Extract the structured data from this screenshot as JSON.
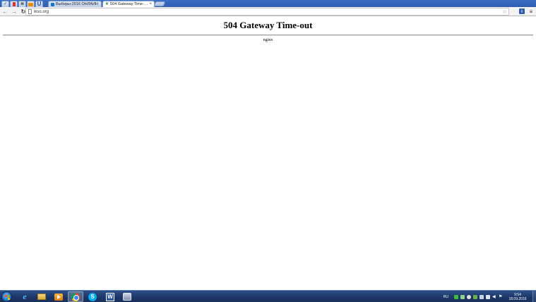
{
  "browser": {
    "tabs": [
      {
        "title": "Выборы-2016 ОНЛАЙН",
        "active": false
      },
      {
        "title": "504 Gateway Time-out",
        "active": true
      }
    ],
    "pinned_tabs": [
      {
        "icon": "vk-icon"
      },
      {
        "icon": "red-bookmark-icon"
      },
      {
        "icon": "wifi-icon"
      },
      {
        "icon": "orange-envelope-icon"
      },
      {
        "icon": "u-icon"
      }
    ],
    "address": "ikso.org",
    "close_glyph": "×"
  },
  "page": {
    "heading": "504 Gateway Time-out",
    "server": "nginx"
  },
  "taskbar": {
    "apps": [
      {
        "name": "internet-explorer",
        "glyph": "e"
      },
      {
        "name": "file-explorer"
      },
      {
        "name": "media-player"
      },
      {
        "name": "chrome",
        "active": true
      },
      {
        "name": "skype",
        "glyph": "S"
      },
      {
        "name": "word",
        "glyph": "W"
      },
      {
        "name": "generic-app"
      }
    ],
    "language": "RU",
    "time": "9:54",
    "date": "18.09.2016"
  },
  "colors": {
    "taskbar": "#1c3566",
    "tabstrip": "#2d5db0",
    "toolbar": "#f3f3f3"
  }
}
